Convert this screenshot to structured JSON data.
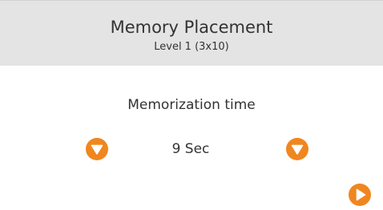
{
  "header": {
    "title": "Memory Placement",
    "subtitle": "Level 1 (3x10)"
  },
  "setting": {
    "label": "Memorization time",
    "value": "9 Sec"
  },
  "controls": {
    "decrease_icon": "triangle-down-icon",
    "increase_icon": "triangle-down-icon",
    "next_icon": "play-icon"
  },
  "colors": {
    "accent": "#f0861f",
    "header_bg": "#e4e4e4",
    "text": "#333333"
  }
}
